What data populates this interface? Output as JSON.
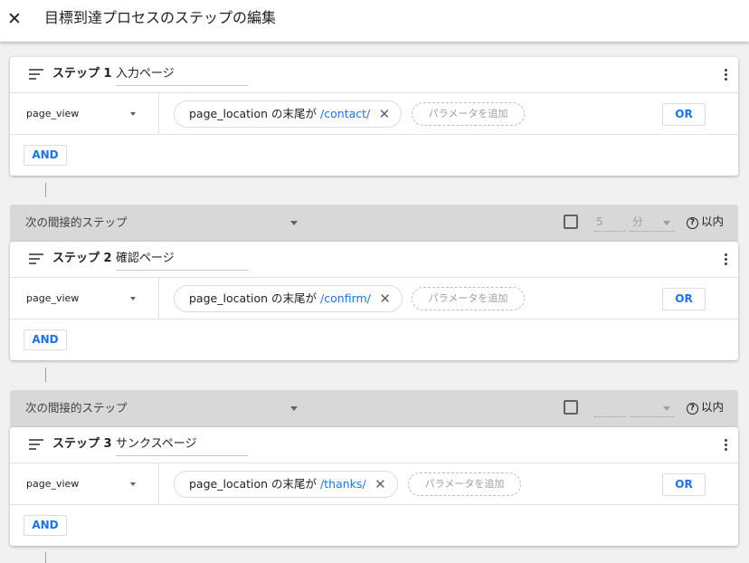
{
  "header": {
    "close_glyph": "✕",
    "title": "目標到達プロセスのステップの編集"
  },
  "steps": [
    {
      "label": "ステップ 1",
      "name": "入力ページ",
      "event": "page_view",
      "condition": {
        "text": "page_location の末尾が",
        "value": "/contact/"
      },
      "add_param_label": "パラメータを追加",
      "or_label": "OR",
      "and_label": "AND"
    },
    {
      "label": "ステップ 2",
      "name": "確認ページ",
      "event": "page_view",
      "condition": {
        "text": "page_location の末尾が",
        "value": "/confirm/"
      },
      "add_param_label": "パラメータを追加",
      "or_label": "OR",
      "and_label": "AND"
    },
    {
      "label": "ステップ 3",
      "name": "サンクスページ",
      "event": "page_view",
      "condition": {
        "text": "page_location の末尾が",
        "value": "/thanks/"
      },
      "add_param_label": "パラメータを追加",
      "or_label": "OR",
      "and_label": "AND"
    }
  ],
  "gaps": [
    {
      "label": "次の間接的ステップ",
      "within_value": "5",
      "within_unit": "分",
      "within_label": "以内",
      "checked": false
    },
    {
      "label": "次の間接的ステップ",
      "within_value": "",
      "within_unit": "",
      "within_label": "以内",
      "checked": false
    }
  ],
  "icons": {
    "close": "close-icon",
    "drag": "drag-handle-icon",
    "more": "more-vert-icon",
    "help": "help-icon",
    "remove": "close-icon",
    "dropdown": "arrow-drop-down-icon"
  },
  "colors": {
    "accent": "#1a73e8",
    "gap_bar": "#d8d8d8",
    "background": "#f1f1f1"
  }
}
